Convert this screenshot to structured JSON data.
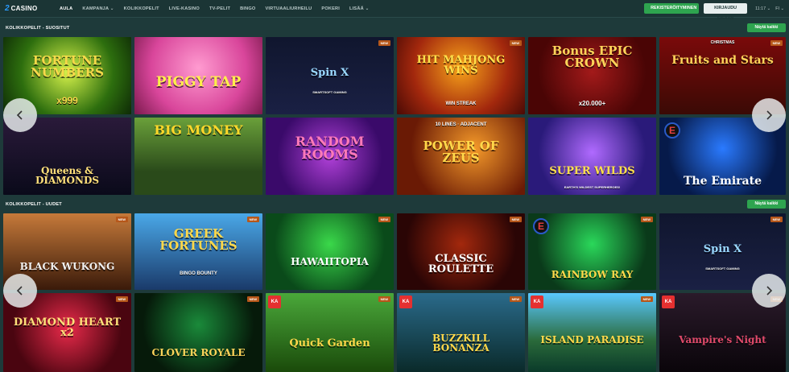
{
  "header": {
    "logo_mark": "2",
    "logo_text": "CASINO",
    "nav": [
      {
        "label": "AULA",
        "active": true
      },
      {
        "label": "KAMPANJA ⌄",
        "active": false
      },
      {
        "label": "KOLIKKOPELIT",
        "active": false
      },
      {
        "label": "LIVE-KASINO",
        "active": false
      },
      {
        "label": "TV-PELIT",
        "active": false
      },
      {
        "label": "BINGO",
        "active": false
      },
      {
        "label": "VIRTUAALIURHEILU",
        "active": false
      },
      {
        "label": "POKERI",
        "active": false
      },
      {
        "label": "LISÄÄ ⌄",
        "active": false
      }
    ],
    "register_label": "REKISTERÖITYMINEN",
    "login_label": "KIRJAUDU SISÄÄN",
    "time": "11:17 ⌄",
    "lang": "FI ⌄"
  },
  "sections": [
    {
      "title": "KOLIKKOPELIT - SUOSITUT",
      "show_all": "Näytä kaikki",
      "games": [
        {
          "title": "FORTUNE NUMBERS",
          "sub": "x999",
          "new": false
        },
        {
          "title": "PIGGY TAP",
          "sub": "",
          "new": false
        },
        {
          "title": "Spin X",
          "sub": "SMARTSOFT GAMING",
          "new": true
        },
        {
          "title": "HIT MAHJONG WINS",
          "sub": "WIN STREAK",
          "new": true
        },
        {
          "title": "Bonus EPIC CROWN",
          "sub": "x20.000+",
          "new": false
        },
        {
          "title": "Fruits and Stars",
          "sub": "CHRISTMAS",
          "new": true
        },
        {
          "title": "Queens & DIAMONDS",
          "sub": "",
          "new": false
        },
        {
          "title": "BIG MONEY",
          "sub": "",
          "new": false
        },
        {
          "title": "RANDOM ROOMS",
          "sub": "",
          "new": false
        },
        {
          "title": "POWER OF ZEUS",
          "sub": "10 LINES · ADJACENT",
          "new": false
        },
        {
          "title": "SUPER WILDS",
          "sub": "EARTH'S WILDEST SUPERHEROES!",
          "new": false
        },
        {
          "title": "The Emirate",
          "sub": "",
          "new": false
        }
      ]
    },
    {
      "title": "KOLIKKOPELIT - UUDET",
      "show_all": "Näytä kaikki",
      "games": [
        {
          "title": "BLACK WUKONG",
          "sub": "",
          "new": true
        },
        {
          "title": "GREEK FORTUNES",
          "sub": "BINGO BOUNTY",
          "new": true
        },
        {
          "title": "HAWAIITOPIA",
          "sub": "",
          "new": true
        },
        {
          "title": "CLASSIC ROULETTE",
          "sub": "",
          "new": true
        },
        {
          "title": "RAINBOW RAY",
          "sub": "",
          "new": true
        },
        {
          "title": "Spin X",
          "sub": "SMARTSOFT GAMING",
          "new": true
        },
        {
          "title": "DIAMOND HEART x2",
          "sub": "",
          "new": true
        },
        {
          "title": "CLOVER ROYALE",
          "sub": "",
          "new": true
        },
        {
          "title": "Quick Garden",
          "sub": "",
          "new": true
        },
        {
          "title": "BUZZKILL BONANZA",
          "sub": "",
          "new": true
        },
        {
          "title": "ISLAND PARADISE",
          "sub": "",
          "new": true
        },
        {
          "title": "Vampire's Night",
          "sub": "",
          "new": true
        }
      ]
    }
  ],
  "badge_new": "NEW",
  "provider_ka": "KA",
  "provider_e": "E",
  "icons": {
    "prev": "chevron-left-icon",
    "next": "chevron-right-icon"
  },
  "colors": {
    "brand_green": "#2ea44f",
    "background": "#1e3a3a",
    "new_badge": "#b6571a"
  }
}
